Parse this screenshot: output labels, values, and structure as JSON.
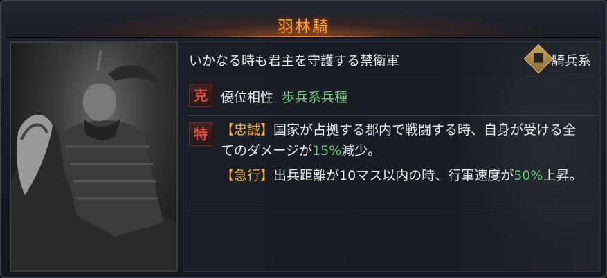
{
  "title": "羽林騎",
  "description": "いかなる時も君主を守護する禁衛軍",
  "unit_type": {
    "label": "騎兵系",
    "icon": "cavalry-horse-icon"
  },
  "advantage": {
    "badge": "克",
    "label": "優位相性",
    "value": "歩兵系兵種"
  },
  "traits_badge": "特",
  "skills": [
    {
      "name": "【忠誠】",
      "text_before": "国家が占拠する郡内で戦闘する時、自身が受ける全てのダメージが",
      "highlight": "15%",
      "text_after": "減少。"
    },
    {
      "name": "【急行】",
      "text_before": "出兵距離が10マス以内の時、行軍速度が",
      "highlight": "50%",
      "text_after": "上昇。"
    }
  ],
  "colors": {
    "title": "#ff9c3c",
    "highlight": "#6cc47a",
    "skill_name": "#f0b24a",
    "badge": "#e04a3a"
  }
}
